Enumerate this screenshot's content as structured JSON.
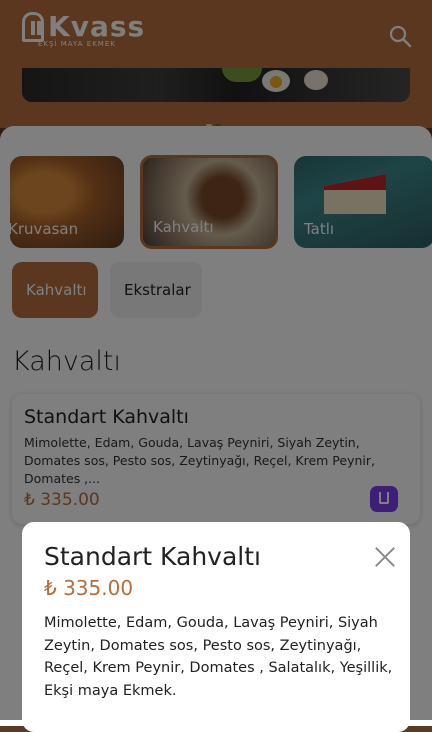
{
  "header": {
    "brand": "Kvass",
    "brand_sub": "EKŞİ MAYA EKMEK"
  },
  "categories": [
    {
      "label": "Kruvasan"
    },
    {
      "label": "Kahvaltı"
    },
    {
      "label": "Tatlı"
    }
  ],
  "tabs": [
    {
      "label": "Kahvaltı",
      "active": true
    },
    {
      "label": "Ekstralar",
      "active": false
    }
  ],
  "section_title": "Kahvaltı",
  "product_card": {
    "title": "Standart Kahvaltı",
    "description": "Mimolette, Edam, Gouda, Lavaş Peyniri, Siyah Zeytin, Domates sos, Pesto sos, Zeytinyağı, Reçel, Krem Peynir, Domates ,...",
    "price": "₺ 335.00"
  },
  "modal": {
    "title": "Standart Kahvaltı",
    "price": "₺ 335.00",
    "description": "Mimolette, Edam, Gouda, Lavaş Peyniri, Siyah Zeytin, Domates sos, Pesto sos, Zeytinyağı, Reçel, Krem Peynir, Domates , Salatalık, Yeşillik, Ekşi maya Ekmek."
  },
  "colors": {
    "brand": "#b46f3c",
    "accent_icon": "#7a3ff0"
  }
}
